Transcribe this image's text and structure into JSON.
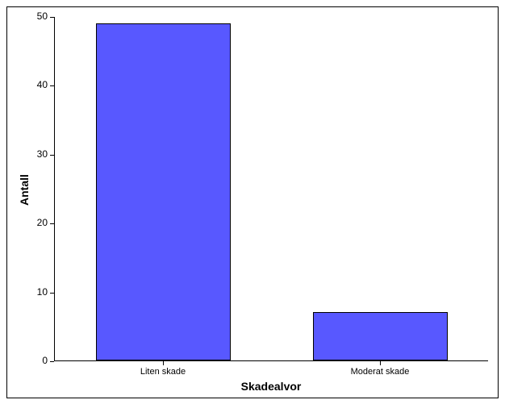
{
  "chart_data": {
    "type": "bar",
    "categories": [
      "Liten skade",
      "Moderat skade"
    ],
    "values": [
      49,
      7
    ],
    "title": "",
    "xlabel": "Skadealvor",
    "ylabel": "Antall",
    "ylim": [
      0,
      50
    ],
    "yticks": [
      0,
      10,
      20,
      30,
      40,
      50
    ]
  }
}
